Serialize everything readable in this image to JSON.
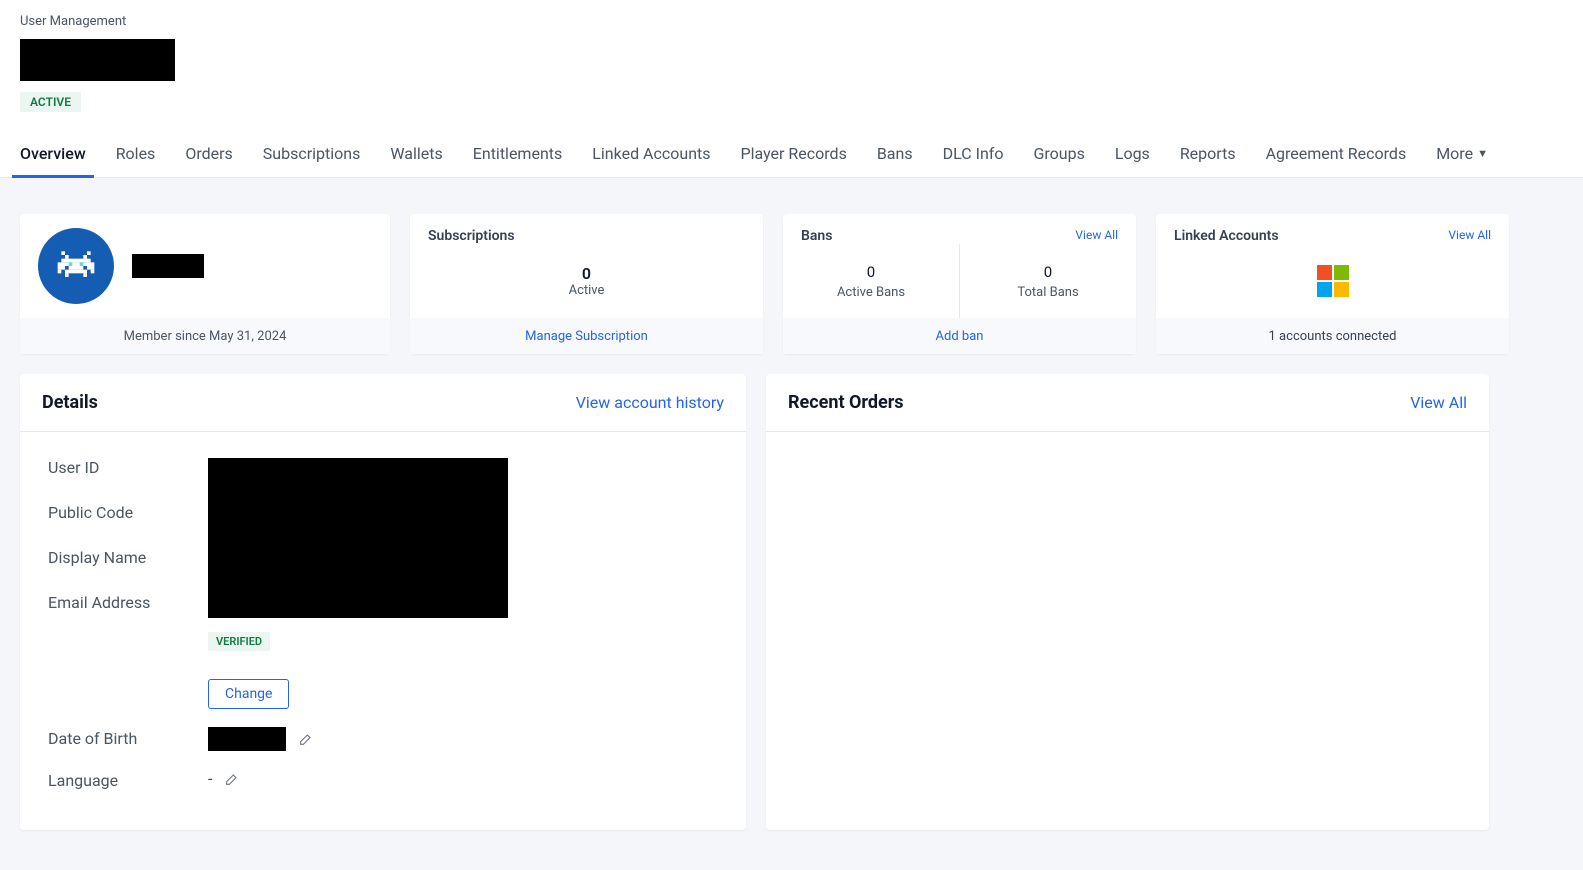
{
  "breadcrumb": "User Management",
  "status": "ACTIVE",
  "tabs": [
    {
      "label": "Overview",
      "active": true
    },
    {
      "label": "Roles"
    },
    {
      "label": "Orders"
    },
    {
      "label": "Subscriptions"
    },
    {
      "label": "Wallets"
    },
    {
      "label": "Entitlements"
    },
    {
      "label": "Linked Accounts"
    },
    {
      "label": "Player Records"
    },
    {
      "label": "Bans"
    },
    {
      "label": "DLC Info"
    },
    {
      "label": "Groups"
    },
    {
      "label": "Logs"
    },
    {
      "label": "Reports"
    },
    {
      "label": "Agreement Records"
    },
    {
      "label": "More"
    }
  ],
  "profile": {
    "memberSince": "Member since May 31, 2024"
  },
  "subscriptions": {
    "title": "Subscriptions",
    "count": "0",
    "subLabel": "Active",
    "manageLabel": "Manage Subscription"
  },
  "bans": {
    "title": "Bans",
    "viewAll": "View All",
    "activeCount": "0",
    "activeLabel": "Active Bans",
    "totalCount": "0",
    "totalLabel": "Total Bans",
    "addLabel": "Add ban"
  },
  "linked": {
    "title": "Linked Accounts",
    "viewAll": "View All",
    "footer": "1 accounts connected"
  },
  "details": {
    "title": "Details",
    "historyLink": "View account history",
    "labels": {
      "userId": "User ID",
      "publicCode": "Public Code",
      "displayName": "Display Name",
      "email": "Email Address",
      "dob": "Date of Birth",
      "language": "Language"
    },
    "verified": "VERIFIED",
    "changeBtn": "Change",
    "languageValue": "-"
  },
  "recentOrders": {
    "title": "Recent Orders",
    "viewAll": "View All"
  }
}
